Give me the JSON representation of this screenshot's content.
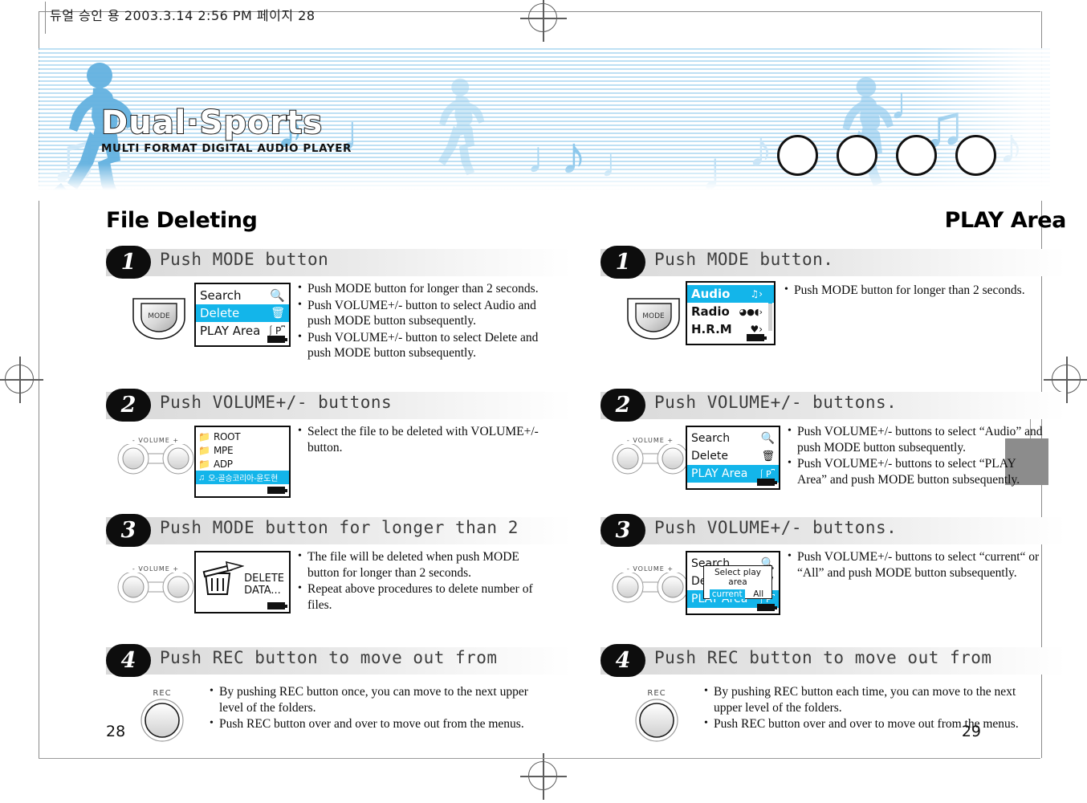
{
  "print": {
    "slug": "듀얼 승인 용  2003.3.14 2:56 PM 페이지 28"
  },
  "banner": {
    "logo_title": "Dual·Sports",
    "logo_subtitle": "MULTI FORMAT DIGITAL AUDIO PLAYER",
    "stripe_color": "#96cdee",
    "accent_color": "#13b5ea"
  },
  "left_page": {
    "page_number": "28",
    "title": "File Deleting",
    "steps": [
      {
        "number": "1",
        "heading": "Push MODE button",
        "control": "MODE",
        "control_label": "MODE",
        "lcd": {
          "type": "menu",
          "items": [
            {
              "label": "Search",
              "icon": "magnifier-icon",
              "selected": false
            },
            {
              "label": "Delete",
              "icon": "trash-icon",
              "selected": true
            },
            {
              "label": "PLAY Area",
              "icon": "play-area-icon",
              "selected": false
            }
          ],
          "battery": "battery-icon"
        },
        "bullets": [
          "Push MODE button for longer than 2 seconds.",
          "Push VOLUME+/- button to select Audio and push MODE button subsequently.",
          "Push VOLUME+/- button to select Delete and push MODE button subsequently."
        ]
      },
      {
        "number": "2",
        "heading": "Push VOLUME+/- buttons",
        "control": "VOLUME",
        "control_label": "- VOLUME +",
        "lcd": {
          "type": "folders",
          "items": [
            {
              "label": "ROOT",
              "icon": "folder-icon",
              "selected": false
            },
            {
              "label": "MPE",
              "icon": "folder-icon",
              "selected": false
            },
            {
              "label": "ADP",
              "icon": "folder-icon",
              "selected": false
            },
            {
              "label": "오-골승코리아-윤도현",
              "icon": "mp3-file-icon",
              "selected": true
            }
          ],
          "battery": "battery-icon"
        },
        "bullets": [
          "Select the file to be deleted with VOLUME+/- button."
        ]
      },
      {
        "number": "3",
        "heading": "Push MODE button for longer than 2",
        "control": "VOLUME",
        "control_label": "- VOLUME +",
        "lcd": {
          "type": "delete",
          "icon": "trash-delete-icon",
          "line1": "DELETE",
          "line2": "DATA...",
          "battery": "battery-icon"
        },
        "bullets": [
          "The file will be deleted when push MODE button for longer than 2 seconds.",
          "Repeat above procedures to delete number of files."
        ]
      },
      {
        "number": "4",
        "heading": "Push REC button to move out from",
        "control": "REC",
        "control_label": "REC",
        "lcd": null,
        "bullets": [
          "By pushing REC button once, you can move to the next upper level of the folders.",
          "Push REC button over and over to move out from the menus."
        ]
      }
    ]
  },
  "right_page": {
    "page_number": "29",
    "title": "PLAY Area",
    "steps": [
      {
        "number": "1",
        "heading": "Push MODE button.",
        "control": "MODE",
        "control_label": "MODE",
        "lcd": {
          "type": "menu-bold",
          "items": [
            {
              "label": "Audio",
              "icon": "music-note-icon",
              "selected": true
            },
            {
              "label": "Radio",
              "icon": "radio-wave-icon",
              "selected": false
            },
            {
              "label": "H.R.M",
              "icon": "heart-icon",
              "selected": false
            }
          ],
          "battery": "battery-icon",
          "scrollbar": true
        },
        "bullets": [
          "Push MODE button for longer than 2 seconds."
        ]
      },
      {
        "number": "2",
        "heading": "Push VOLUME+/- buttons.",
        "control": "VOLUME",
        "control_label": "- VOLUME +",
        "lcd": {
          "type": "menu",
          "items": [
            {
              "label": "Search",
              "icon": "magnifier-icon",
              "selected": false
            },
            {
              "label": "Delete",
              "icon": "trash-icon",
              "selected": false
            },
            {
              "label": "PLAY Area",
              "icon": "play-area-icon",
              "selected": true
            }
          ],
          "battery": "battery-icon"
        },
        "bullets": [
          "Push VOLUME+/- buttons to select “Audio” and push MODE button subsequently.",
          "Push VOLUME+/- buttons to select “PLAY Area” and push MODE button subsequently."
        ]
      },
      {
        "number": "3",
        "heading": "Push VOLUME+/- buttons.",
        "control": "VOLUME",
        "control_label": "- VOLUME +",
        "lcd": {
          "type": "menu-popup",
          "items": [
            {
              "label": "Search",
              "icon": "magnifier-icon",
              "selected": false
            },
            {
              "label": "Delete",
              "icon": "trash-icon",
              "selected": false
            },
            {
              "label": "PLAY Area",
              "icon": "play-area-icon",
              "selected": true
            }
          ],
          "popup": {
            "title": "Select play area",
            "options": [
              {
                "label": "current",
                "selected": true
              },
              {
                "label": "All",
                "selected": false
              }
            ]
          },
          "battery": "battery-icon"
        },
        "bullets": [
          "Push VOLUME+/- buttons to select “current“ or “All” and push MODE button subsequently."
        ]
      },
      {
        "number": "4",
        "heading": "Push REC button to move out from",
        "control": "REC",
        "control_label": "REC",
        "lcd": null,
        "bullets": [
          "By pushing REC button each time, you can move to the next upper level of the folders.",
          "Push REC button over and over to move out from the menus."
        ]
      }
    ]
  }
}
